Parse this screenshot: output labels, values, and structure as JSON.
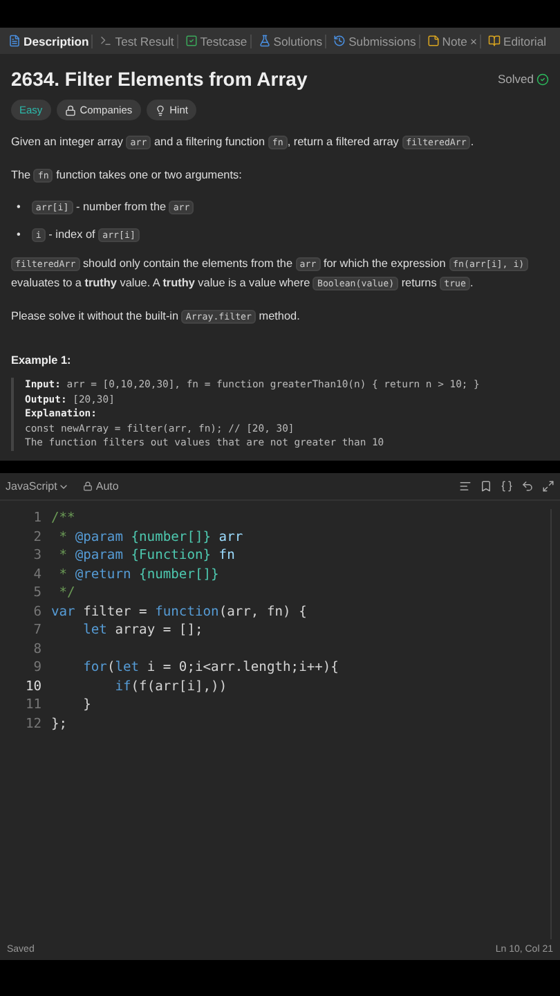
{
  "tabs": [
    {
      "label": "Description",
      "selected": true
    },
    {
      "label": "Test Result",
      "selected": false
    },
    {
      "label": "Testcase",
      "selected": false
    },
    {
      "label": "Solutions",
      "selected": false
    },
    {
      "label": "Submissions",
      "selected": false
    },
    {
      "label": "Note",
      "selected": false,
      "closable": "×"
    },
    {
      "label": "Editorial",
      "selected": false
    }
  ],
  "problem": {
    "title": "2634. Filter Elements from Array",
    "status": "Solved",
    "difficulty": "Easy",
    "tags": [
      {
        "label": "Companies"
      },
      {
        "label": "Hint"
      }
    ],
    "paragraphs": [
      {
        "kind": "para",
        "segments": [
          {
            "kind": "text",
            "text": "Given an integer array "
          },
          {
            "kind": "code",
            "text": "arr"
          },
          {
            "kind": "text",
            "text": " and a filtering function "
          },
          {
            "kind": "code",
            "text": "fn"
          },
          {
            "kind": "text",
            "text": ", return a filtered array "
          },
          {
            "kind": "code",
            "text": "filteredArr"
          },
          {
            "kind": "text",
            "text": "."
          }
        ]
      },
      {
        "kind": "para",
        "segments": [
          {
            "kind": "text",
            "text": "The "
          },
          {
            "kind": "code",
            "text": "fn"
          },
          {
            "kind": "text",
            "text": " function takes one or two arguments:"
          }
        ]
      },
      {
        "kind": "bullet",
        "marker": "•",
        "segments": [
          {
            "kind": "code",
            "text": "arr[i]"
          },
          {
            "kind": "text",
            "text": " - number from the "
          },
          {
            "kind": "code",
            "text": "arr"
          }
        ]
      },
      {
        "kind": "bullet",
        "marker": "•",
        "segments": [
          {
            "kind": "code",
            "text": "i"
          },
          {
            "kind": "text",
            "text": " - index of "
          },
          {
            "kind": "code",
            "text": "arr[i]"
          }
        ]
      },
      {
        "kind": "para",
        "segments": [
          {
            "kind": "code",
            "text": "filteredArr"
          },
          {
            "kind": "text",
            "text": " should only contain the elements from the "
          },
          {
            "kind": "code",
            "text": "arr"
          },
          {
            "kind": "text",
            "text": " for which the expression "
          },
          {
            "kind": "code",
            "text": "fn(arr[i], i)"
          },
          {
            "kind": "text",
            "text": " evaluates to a "
          },
          {
            "kind": "bold",
            "text": "truthy"
          },
          {
            "kind": "text",
            "text": " value. A "
          },
          {
            "kind": "bold",
            "text": "truthy"
          },
          {
            "kind": "text",
            "text": " value is a value where "
          },
          {
            "kind": "code",
            "text": "Boolean(value)"
          },
          {
            "kind": "text",
            "text": " returns "
          },
          {
            "kind": "code",
            "text": "true"
          },
          {
            "kind": "text",
            "text": "."
          }
        ]
      },
      {
        "kind": "para",
        "segments": [
          {
            "kind": "text",
            "text": "Please solve it without the built-in "
          },
          {
            "kind": "code",
            "text": "Array.filter"
          },
          {
            "kind": "text",
            "text": " method."
          }
        ]
      }
    ],
    "example": {
      "heading": "Example 1:",
      "lines": [
        {
          "label": "Input:",
          "text": " arr = [0,10,20,30], fn = function greaterThan10(n) { return n > 10; }"
        },
        {
          "label": "Output:",
          "text": " [20,30]"
        },
        {
          "label": "Explanation:"
        },
        {
          "text": "const newArray = filter(arr, fn); // [20, 30]"
        },
        {
          "text": "The function filters out values that are not greater than 10"
        }
      ]
    }
  },
  "editor": {
    "language": "JavaScript",
    "mode": "Auto",
    "lines": [
      {
        "number": "1",
        "tokens": [
          {
            "kind": "comment",
            "text": "/**"
          }
        ]
      },
      {
        "number": "2",
        "tokens": [
          {
            "kind": "comment",
            "text": " * "
          },
          {
            "kind": "tag",
            "text": "@param"
          },
          {
            "kind": "type",
            "text": " {number[]} "
          },
          {
            "kind": "param",
            "text": "arr"
          }
        ]
      },
      {
        "number": "3",
        "tokens": [
          {
            "kind": "comment",
            "text": " * "
          },
          {
            "kind": "tag",
            "text": "@param"
          },
          {
            "kind": "type",
            "text": " {Function} "
          },
          {
            "kind": "param",
            "text": "fn"
          }
        ]
      },
      {
        "number": "4",
        "tokens": [
          {
            "kind": "comment",
            "text": " * "
          },
          {
            "kind": "tag",
            "text": "@return"
          },
          {
            "kind": "type",
            "text": " {number[]}"
          }
        ]
      },
      {
        "number": "5",
        "tokens": [
          {
            "kind": "comment",
            "text": " */"
          }
        ]
      },
      {
        "number": "6",
        "tokens": [
          {
            "kind": "keyword",
            "text": "var"
          },
          {
            "kind": "plain",
            "text": " filter = "
          },
          {
            "kind": "keyword",
            "text": "function"
          },
          {
            "kind": "plain",
            "text": "(arr, fn) {"
          }
        ]
      },
      {
        "number": "7",
        "tokens": [
          {
            "kind": "keyword",
            "text": "    let"
          },
          {
            "kind": "plain",
            "text": " array = [];"
          }
        ]
      },
      {
        "number": "8"
      },
      {
        "number": "9",
        "tokens": [
          {
            "kind": "keyword",
            "text": "    for"
          },
          {
            "kind": "plain",
            "text": "("
          },
          {
            "kind": "keyword",
            "text": "let"
          },
          {
            "kind": "plain",
            "text": " i = 0;i<arr.length;i++){"
          }
        ]
      },
      {
        "number": "10",
        "current": true,
        "tokens": [
          {
            "kind": "keyword",
            "text": "        if"
          },
          {
            "kind": "plain",
            "text": "(f(arr[i],)"
          },
          {
            "kind": "plain",
            "text": ")"
          }
        ]
      },
      {
        "number": "11",
        "tokens": [
          {
            "kind": "plain",
            "text": "    }"
          }
        ]
      },
      {
        "number": "12",
        "tokens": [
          {
            "kind": "plain",
            "text": "};"
          }
        ]
      }
    ]
  },
  "status_bar": {
    "left": "Saved",
    "right": "Ln 10, Col 21"
  }
}
